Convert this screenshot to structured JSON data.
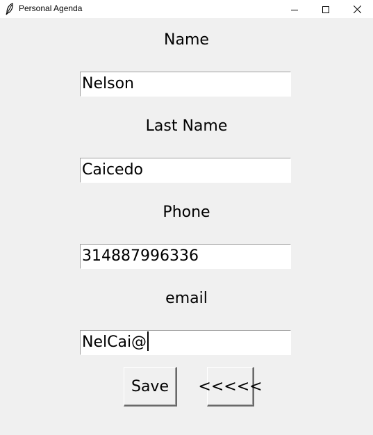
{
  "window": {
    "title": "Personal Agenda",
    "minimize_icon": "minimize-icon",
    "maximize_icon": "maximize-icon",
    "close_icon": "close-icon"
  },
  "form": {
    "name_label": "Name",
    "name_value": "Nelson",
    "last_name_label": "Last Name",
    "last_name_value": "Caicedo",
    "phone_label": "Phone",
    "phone_value": "314887996336",
    "email_label": "email",
    "email_value": "NelCai@"
  },
  "buttons": {
    "save_label": "Save",
    "back_label": "<<<<<"
  }
}
